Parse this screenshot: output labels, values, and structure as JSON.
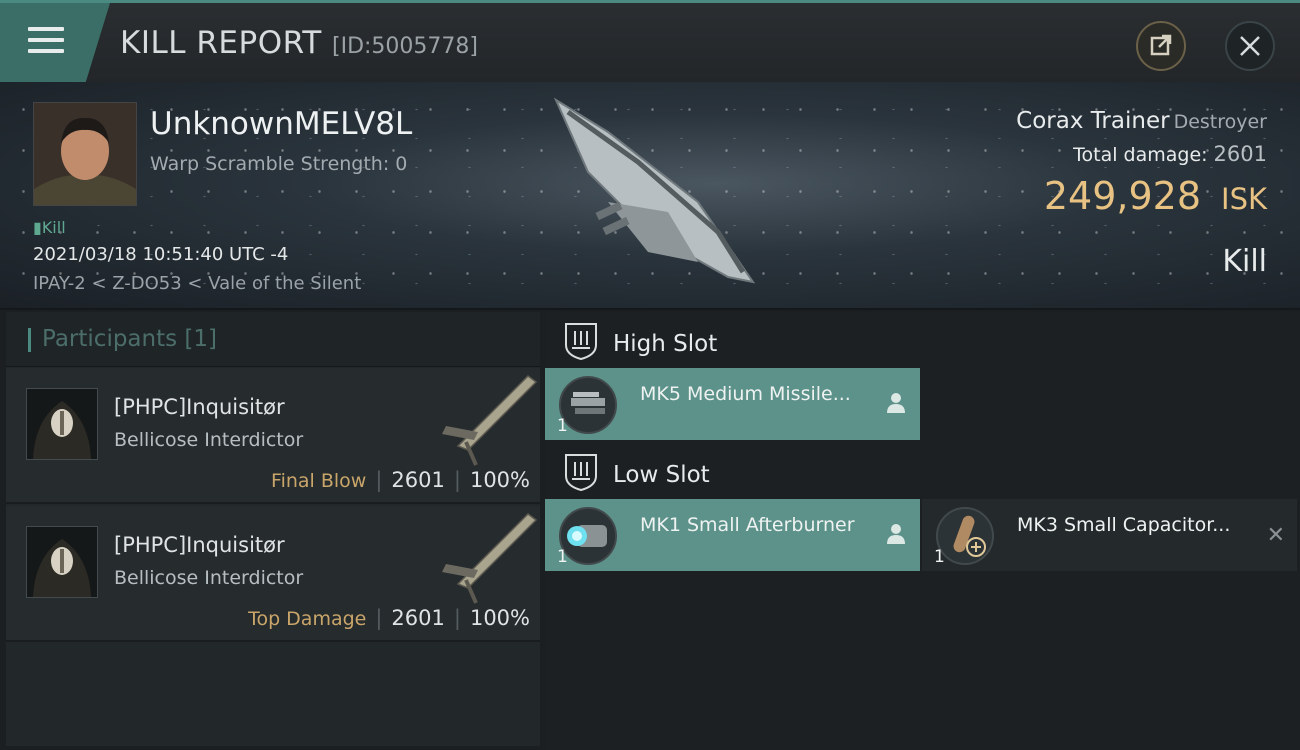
{
  "window": {
    "title": "KILL REPORT",
    "id_label": "[ID:5005778]"
  },
  "victim": {
    "name": "UnknownMELV8L",
    "warp_scramble": "Warp Scramble Strength: 0",
    "tag": "Kill",
    "datetime": "2021/03/18 10:51:40 UTC -4",
    "location": "IPAY-2 < Z-DO53 < Vale of the Silent"
  },
  "ship": {
    "name": "Corax Trainer",
    "class": "Destroyer",
    "damage_label": "Total damage:",
    "damage_value": "2601",
    "isk_value": "249,928",
    "isk_unit": "ISK",
    "result": "Kill"
  },
  "participants": {
    "header": "Participants",
    "count": "[1]",
    "items": [
      {
        "name": "[PHPC]Inquisitør",
        "ship": "Bellicose Interdictor",
        "tag": "Final Blow",
        "damage": "2601",
        "percent": "100%"
      },
      {
        "name": "[PHPC]Inquisitør",
        "ship": "Bellicose Interdictor",
        "tag": "Top Damage",
        "damage": "2601",
        "percent": "100%"
      }
    ]
  },
  "slots": {
    "high": {
      "label": "High Slot",
      "modules": [
        {
          "name": "MK5 Medium Missile...",
          "qty": "1"
        }
      ]
    },
    "low": {
      "label": "Low Slot",
      "modules": [
        {
          "name": "MK1 Small Afterburner",
          "qty": "1"
        },
        {
          "name": "MK3 Small Capacitor...",
          "qty": "1"
        }
      ]
    }
  },
  "colors": {
    "accent": "#4a8a80",
    "isk": "#e8c283",
    "fitted": "#5c928a"
  }
}
